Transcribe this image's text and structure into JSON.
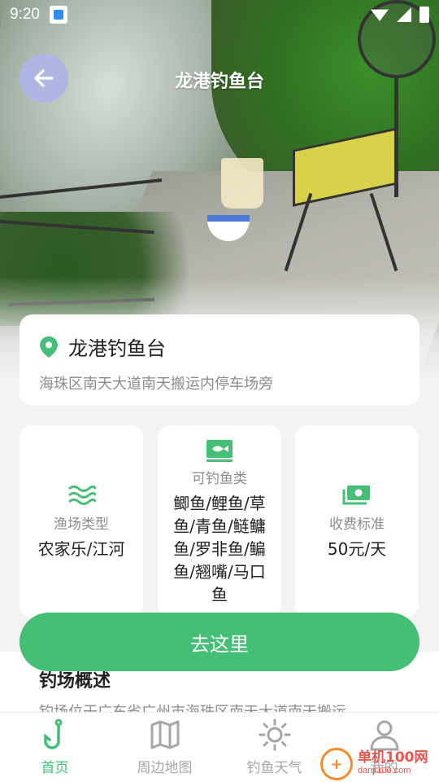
{
  "status_bar": {
    "time": "9:20"
  },
  "header": {
    "title": "龙港钓鱼台"
  },
  "location": {
    "name": "龙港钓鱼台",
    "address": "海珠区南天大道南天搬运内停车场旁"
  },
  "info": [
    {
      "label": "渔场类型",
      "value": "农家乐/江河"
    },
    {
      "label": "可钓鱼类",
      "value": "鲫鱼/鲤鱼/草鱼/青鱼/鲢鳙鱼/罗非鱼/鳊鱼/翘嘴/马口鱼"
    },
    {
      "label": "收费标准",
      "value": "50元/天"
    }
  ],
  "go_button": "去这里",
  "overview": {
    "title": "钓场概述",
    "text": "钓场位于广东省广州市海珠区南天大道南天搬运"
  },
  "nav": [
    {
      "label": "首页",
      "icon": "fishing-hook-icon",
      "active": true
    },
    {
      "label": "周边地图",
      "icon": "map-icon",
      "active": false
    },
    {
      "label": "钓鱼天气",
      "icon": "sun-icon",
      "active": false
    },
    {
      "label": "我的",
      "icon": "user-icon",
      "active": false
    }
  ],
  "watermark": {
    "cn": "单机100网",
    "en": "danji100.com"
  },
  "colors": {
    "accent": "#45be76",
    "back_button": "#aeb6e3"
  }
}
